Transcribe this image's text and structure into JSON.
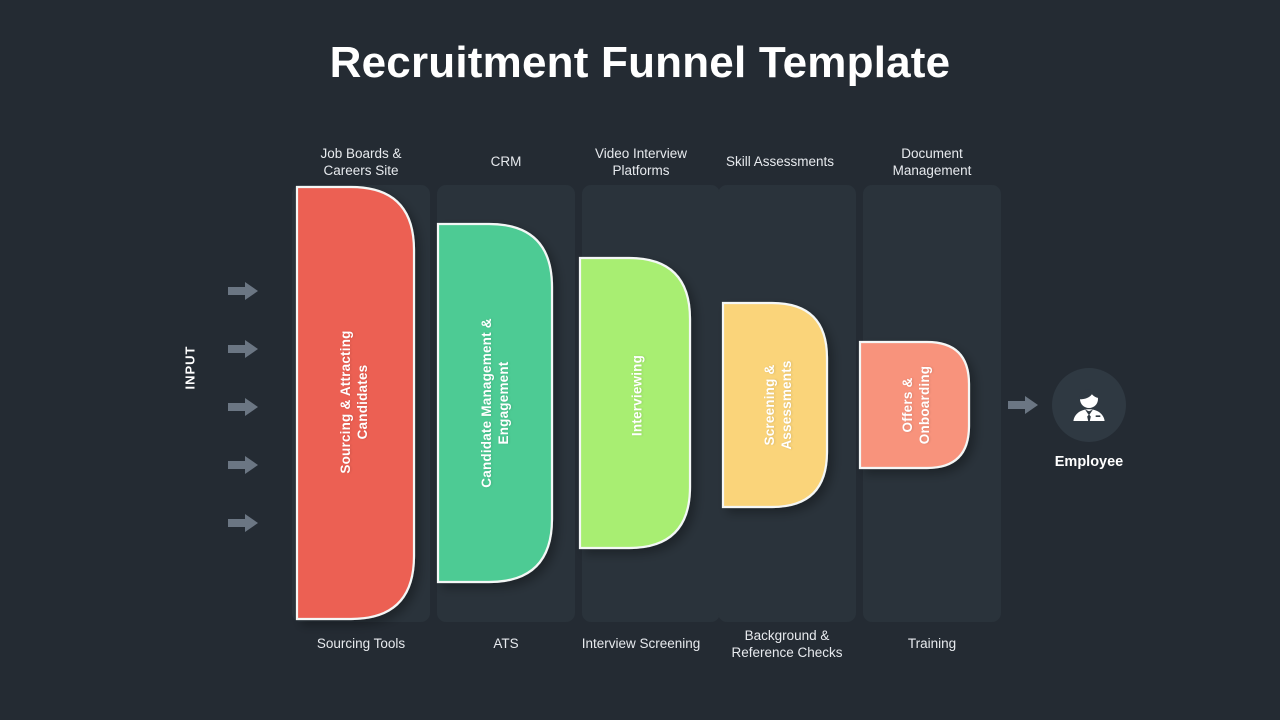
{
  "page": {
    "title": "Recruitment Funnel Template",
    "background_color": "#242b33",
    "card_color": "#2a333b"
  },
  "input": {
    "label": "INPUT",
    "arrow_icon": "arrow-right-icon",
    "arrow_color": "#6b7683",
    "arrow_count": 5
  },
  "funnel": {
    "stages": [
      {
        "name": "Sourcing & Attracting Candidates",
        "top_label": "Job Boards &\nCareers Site",
        "bottom_label": "Sourcing Tools",
        "color": "#ec6053"
      },
      {
        "name": "Candidate Management &\nEngagement",
        "top_label": "CRM",
        "bottom_label": "ATS",
        "color": "#4ecb94"
      },
      {
        "name": "Interviewing",
        "top_label": "Video Interview\nPlatforms",
        "bottom_label": "Interview Screening",
        "color": "#a8ee72"
      },
      {
        "name": "Screening &\nAssessments",
        "top_label": "Skill Assessments",
        "bottom_label": "Background &\nReference Checks",
        "color": "#fad47a"
      },
      {
        "name": "Offers &\nOnboarding",
        "top_label": "Document\nManagement",
        "bottom_label": "Training",
        "color": "#f8937c"
      }
    ]
  },
  "output": {
    "arrow_icon": "arrow-right-icon",
    "icon": "employee-avatar-icon",
    "label": "Employee",
    "circle_color": "#2f3942"
  },
  "chart_data": {
    "type": "funnel",
    "title": "Recruitment Funnel Template",
    "stages": [
      {
        "label": "Sourcing & Attracting Candidates",
        "width_ratio": 1.0
      },
      {
        "label": "Candidate Management & Engagement",
        "width_ratio": 0.8
      },
      {
        "label": "Interviewing",
        "width_ratio": 0.61
      },
      {
        "label": "Screening & Assessments",
        "width_ratio": 0.43
      },
      {
        "label": "Offers & Onboarding",
        "width_ratio": 0.25
      }
    ]
  }
}
